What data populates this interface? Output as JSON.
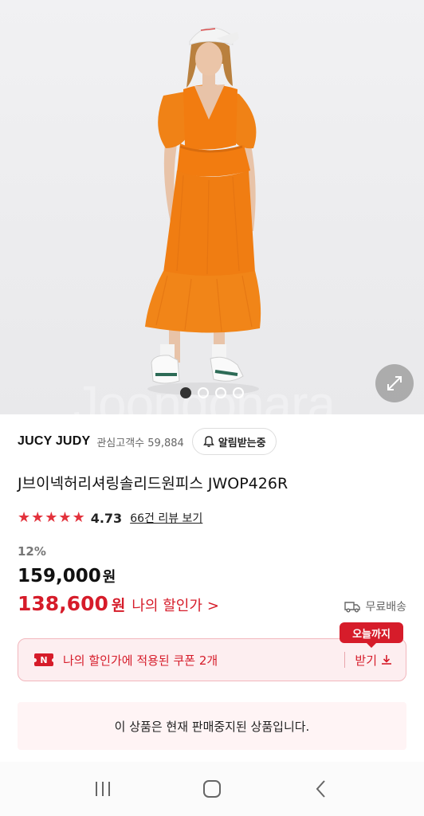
{
  "product": {
    "brand": "JUCY JUDY",
    "interest_label": "관심고객수",
    "interest_count": "59,884",
    "alert_label": "알림받는중",
    "title": "J브이넥허리셔링솔리드원피스 JWOP426R",
    "rating": "4.73",
    "rating_stars": 4.73,
    "review_link": "66건 리뷰 보기",
    "discount": "12%",
    "original_price": "159,000",
    "original_currency": "원",
    "my_price": "138,600",
    "my_currency": "원",
    "my_price_label": "나의 할인가",
    "my_price_chevron": ">",
    "shipping": "무료배송"
  },
  "gallery": {
    "watermark": "Joongonara",
    "page_count": 4,
    "active_page": 1,
    "expand_icon": "expand-arrows-icon"
  },
  "coupon": {
    "badge": "오늘까지",
    "icon_label": "N",
    "text": "나의 할인가에 적용된 쿠폰 2개",
    "get_label": "받기"
  },
  "status": {
    "soldout_message": "이 상품은 현재 판매중지된 상품입니다."
  },
  "colors": {
    "accent_red": "#d61c2a",
    "dress_orange": "#f07d12"
  },
  "system_nav": {
    "recent": "recent-apps-icon",
    "home": "home-icon",
    "back": "back-icon"
  }
}
